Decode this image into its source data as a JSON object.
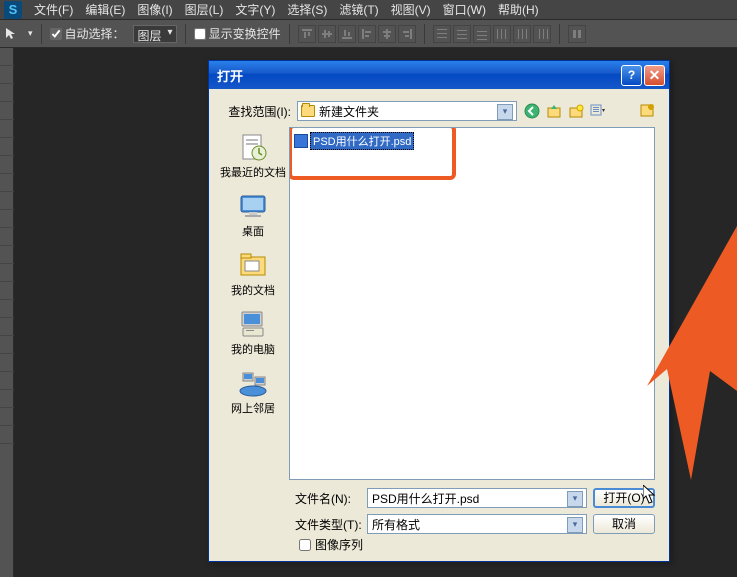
{
  "menubar": {
    "items": [
      "文件(F)",
      "编辑(E)",
      "图像(I)",
      "图层(L)",
      "文字(Y)",
      "选择(S)",
      "滤镜(T)",
      "视图(V)",
      "窗口(W)",
      "帮助(H)"
    ]
  },
  "optionsbar": {
    "auto_select": "自动选择：",
    "layer_dropdown": "图层",
    "show_transform": "显示变换控件"
  },
  "dialog": {
    "title": "打开",
    "look_in_label": "查找范围(I):",
    "look_in_value": "新建文件夹",
    "places": [
      {
        "label": "我最近的文档"
      },
      {
        "label": "桌面"
      },
      {
        "label": "我的文档"
      },
      {
        "label": "我的电脑"
      },
      {
        "label": "网上邻居"
      }
    ],
    "file_item": "PSD用什么打开.psd",
    "filename_label": "文件名(N):",
    "filename_value": "PSD用什么打开.psd",
    "filetype_label": "文件类型(T):",
    "filetype_value": "所有格式",
    "open_btn": "打开(O)",
    "cancel_btn": "取消",
    "image_sequence": "图像序列"
  }
}
